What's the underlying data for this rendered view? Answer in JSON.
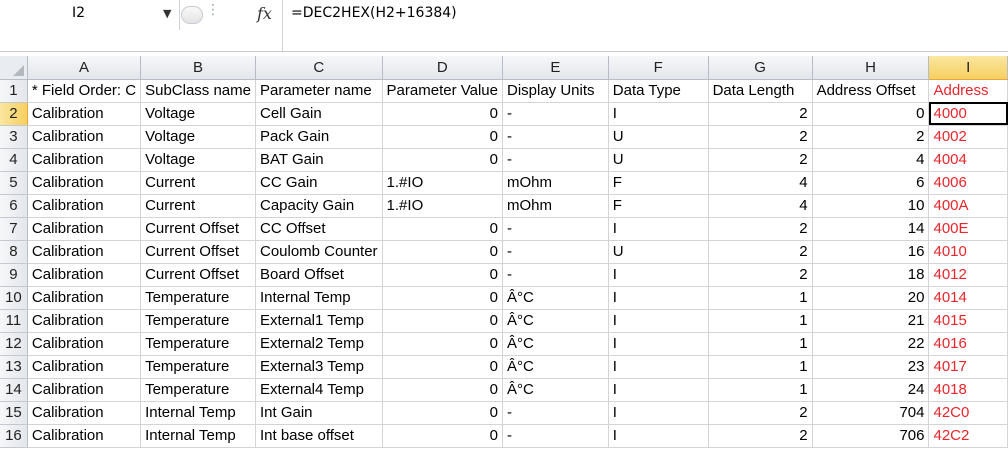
{
  "formula_bar": {
    "name_box": "I2",
    "formula": "=DEC2HEX(H2+16384)",
    "fx_label": "fx"
  },
  "columns": [
    "A",
    "B",
    "C",
    "D",
    "E",
    "F",
    "G",
    "H",
    "I"
  ],
  "rows": [
    {
      "n": "1",
      "cells": [
        "* Field Order: C",
        "SubClass name",
        "Parameter name",
        "Parameter Value",
        "Display Units",
        "Data Type",
        "Data Length",
        "Address Offset",
        "Address"
      ]
    },
    {
      "n": "2",
      "cells": [
        "Calibration",
        "Voltage",
        "Cell Gain",
        "0",
        "-",
        "I",
        "2",
        "0",
        "4000"
      ]
    },
    {
      "n": "3",
      "cells": [
        "Calibration",
        "Voltage",
        "Pack Gain",
        "0",
        "-",
        "U",
        "2",
        "2",
        "4002"
      ]
    },
    {
      "n": "4",
      "cells": [
        "Calibration",
        "Voltage",
        "BAT Gain",
        "0",
        "-",
        "U",
        "2",
        "4",
        "4004"
      ]
    },
    {
      "n": "5",
      "cells": [
        "Calibration",
        "Current",
        "CC Gain",
        "1.#IO",
        "mOhm",
        "F",
        "4",
        "6",
        "4006"
      ]
    },
    {
      "n": "6",
      "cells": [
        "Calibration",
        "Current",
        "Capacity Gain",
        "1.#IO",
        "mOhm",
        "F",
        "4",
        "10",
        "400A"
      ]
    },
    {
      "n": "7",
      "cells": [
        "Calibration",
        "Current Offset",
        "CC Offset",
        "0",
        "-",
        "I",
        "2",
        "14",
        "400E"
      ]
    },
    {
      "n": "8",
      "cells": [
        "Calibration",
        "Current Offset",
        "Coulomb Counter",
        "0",
        "-",
        "U",
        "2",
        "16",
        "4010"
      ]
    },
    {
      "n": "9",
      "cells": [
        "Calibration",
        "Current Offset",
        "Board Offset",
        "0",
        "-",
        "I",
        "2",
        "18",
        "4012"
      ]
    },
    {
      "n": "10",
      "cells": [
        "Calibration",
        "Temperature",
        "Internal Temp",
        "0",
        "Â°C",
        "I",
        "1",
        "20",
        "4014"
      ]
    },
    {
      "n": "11",
      "cells": [
        "Calibration",
        "Temperature",
        "External1 Temp",
        "0",
        "Â°C",
        "I",
        "1",
        "21",
        "4015"
      ]
    },
    {
      "n": "12",
      "cells": [
        "Calibration",
        "Temperature",
        "External2 Temp",
        "0",
        "Â°C",
        "I",
        "1",
        "22",
        "4016"
      ]
    },
    {
      "n": "13",
      "cells": [
        "Calibration",
        "Temperature",
        "External3 Temp",
        "0",
        "Â°C",
        "I",
        "1",
        "23",
        "4017"
      ]
    },
    {
      "n": "14",
      "cells": [
        "Calibration",
        "Temperature",
        "External4 Temp",
        "0",
        "Â°C",
        "I",
        "1",
        "24",
        "4018"
      ]
    },
    {
      "n": "15",
      "cells": [
        "Calibration",
        "Internal Temp",
        "Int Gain",
        "0",
        "-",
        "I",
        "2",
        "704",
        "42C0"
      ]
    },
    {
      "n": "16",
      "cells": [
        "Calibration",
        "Internal Temp",
        "Int base offset",
        "0",
        "-",
        "I",
        "2",
        "706",
        "42C2"
      ]
    }
  ],
  "colors": {
    "address_text": "#e8262b",
    "selected_header": "#f6cf60"
  }
}
